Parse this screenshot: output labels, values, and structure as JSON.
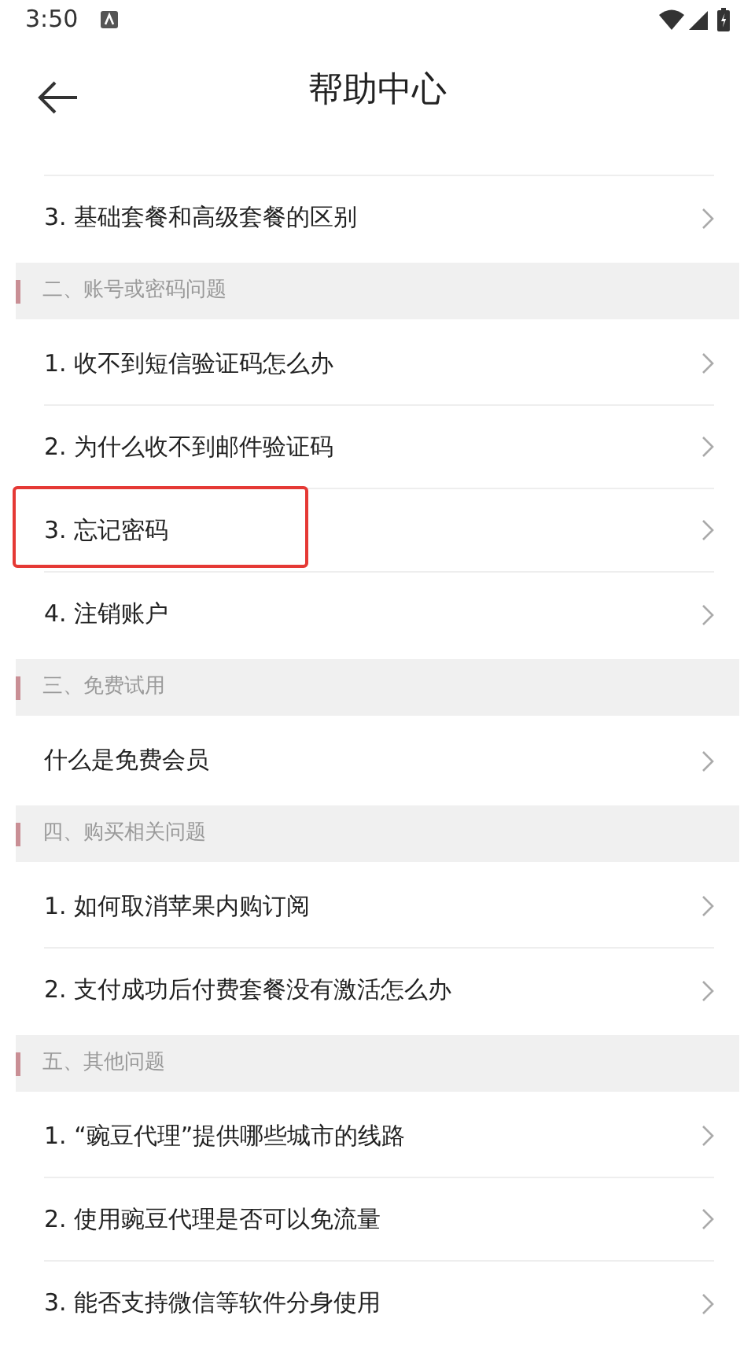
{
  "status_bar": {
    "time": "3:50"
  },
  "header": {
    "title": "帮助中心"
  },
  "sections": [
    {
      "items": [
        {
          "label": "3. 基础套餐和高级套餐的区别",
          "highlighted": false
        }
      ]
    },
    {
      "title": "二、账号或密码问题",
      "items": [
        {
          "label": "1. 收不到短信验证码怎么办",
          "highlighted": false
        },
        {
          "label": "2. 为什么收不到邮件验证码",
          "highlighted": false
        },
        {
          "label": "3. 忘记密码",
          "highlighted": true
        },
        {
          "label": "4. 注销账户",
          "highlighted": false
        }
      ]
    },
    {
      "title": "三、免费试用",
      "items": [
        {
          "label": "什么是免费会员",
          "highlighted": false
        }
      ]
    },
    {
      "title": "四、购买相关问题",
      "items": [
        {
          "label": "1. 如何取消苹果内购订阅",
          "highlighted": false
        },
        {
          "label": "2. 支付成功后付费套餐没有激活怎么办",
          "highlighted": false
        }
      ]
    },
    {
      "title": "五、其他问题",
      "items": [
        {
          "label": "1. “豌豆代理”提供哪些城市的线路",
          "highlighted": false
        },
        {
          "label": "2. 使用豌豆代理是否可以免流量",
          "highlighted": false
        },
        {
          "label": "3. 能否支持微信等软件分身使用",
          "highlighted": false
        }
      ]
    }
  ]
}
